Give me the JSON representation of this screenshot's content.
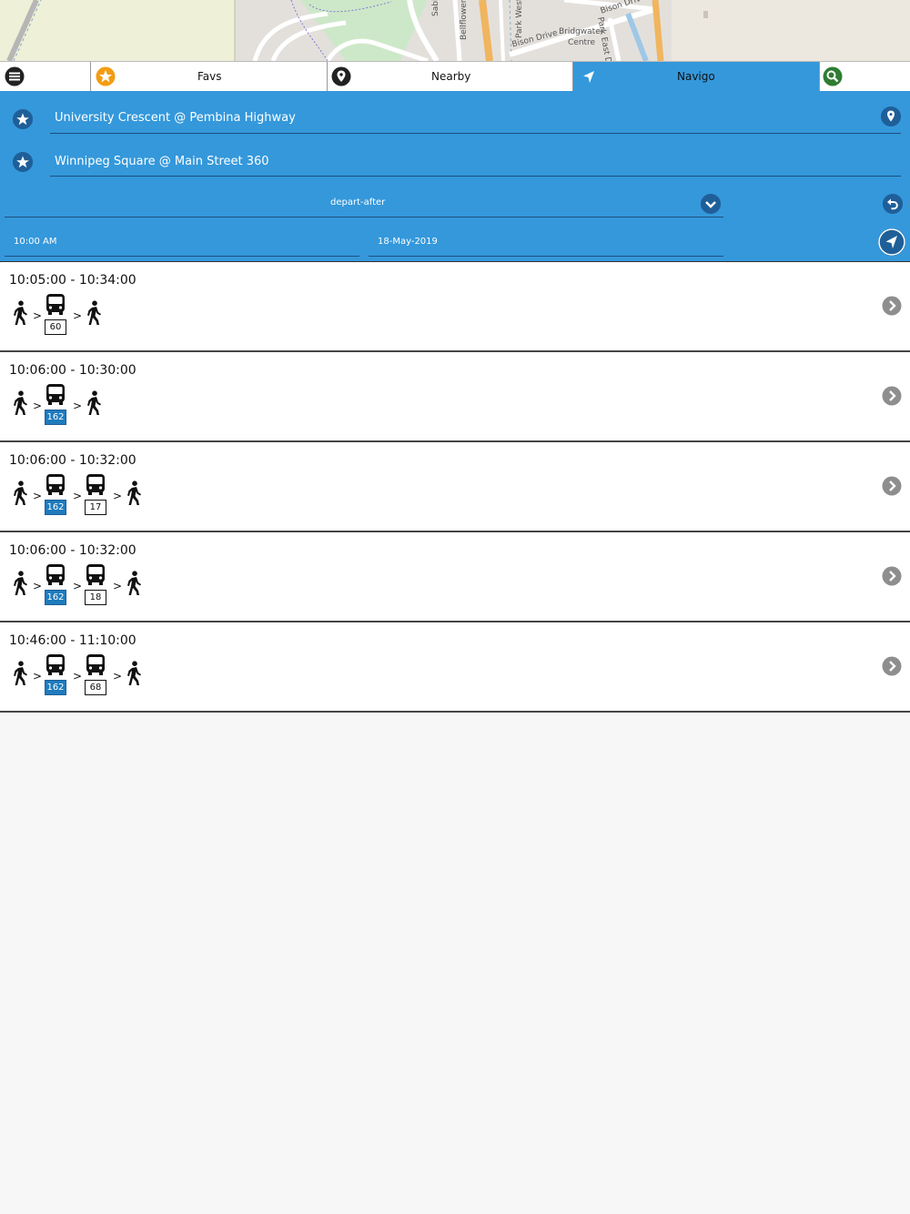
{
  "map": {
    "labels": [
      "Bison Drive",
      "Bison Drive",
      "Bridgwater",
      "Centre",
      "Park West D",
      "Park East Dr",
      "Bellflower Rd",
      "Sable"
    ]
  },
  "tabs": {
    "favs": "Favs",
    "nearby": "Nearby",
    "navigo": "Navigo"
  },
  "trip": {
    "from": "University Crescent @ Pembina Highway",
    "to": "Winnipeg Square @ Main Street 360",
    "mode": "depart-after",
    "time": "10:00 AM",
    "date": "18-May-2019"
  },
  "results": [
    {
      "time": "10:05:00 - 10:34:00",
      "legs": [
        {
          "route": "60",
          "highlight": false
        }
      ]
    },
    {
      "time": "10:06:00 - 10:30:00",
      "legs": [
        {
          "route": "162",
          "highlight": true
        }
      ]
    },
    {
      "time": "10:06:00 - 10:32:00",
      "legs": [
        {
          "route": "162",
          "highlight": true
        },
        {
          "route": "17",
          "highlight": false
        }
      ]
    },
    {
      "time": "10:06:00 - 10:32:00",
      "legs": [
        {
          "route": "162",
          "highlight": true
        },
        {
          "route": "18",
          "highlight": false
        }
      ]
    },
    {
      "time": "10:46:00 - 11:10:00",
      "legs": [
        {
          "route": "162",
          "highlight": true
        },
        {
          "route": "68",
          "highlight": false
        }
      ]
    }
  ],
  "separator": ">",
  "colors": {
    "panel": "#3498db",
    "accent_dark": "#1f5f99",
    "favs_icon": "#f39c12",
    "search_icon": "#2e7d32",
    "route_highlight": "#1f7bbd"
  }
}
